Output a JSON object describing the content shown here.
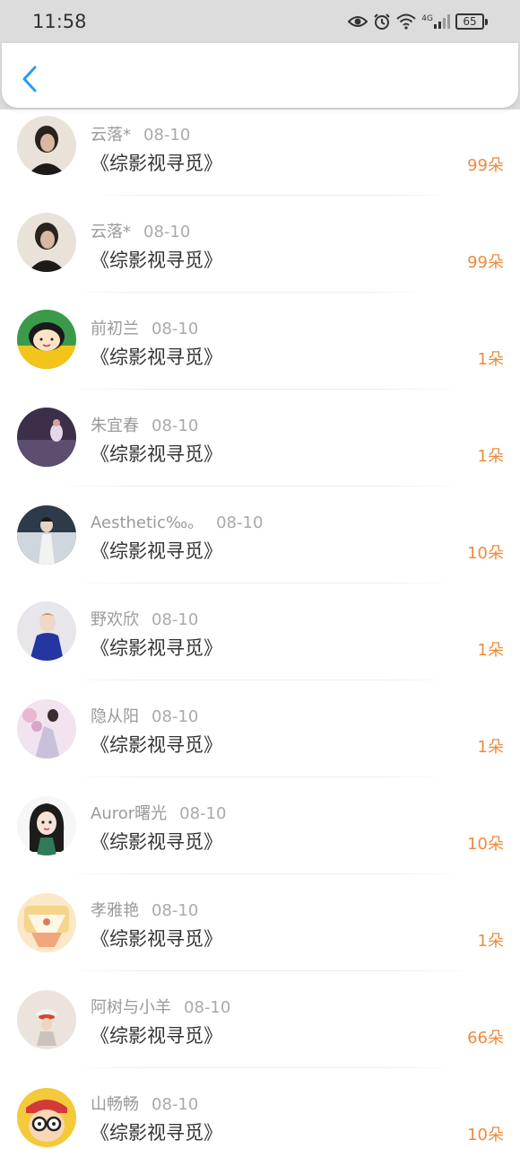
{
  "status_bar": {
    "time": "11:58",
    "battery": "65",
    "network": "4G"
  },
  "header": {
    "back_icon": "chevron-left-icon"
  },
  "colors": {
    "accent_blue": "#2b9cf2",
    "amount_orange": "#f08a3c"
  },
  "items": [
    {
      "name": "云落*",
      "date": "08-10",
      "title": "《综影视寻觅》",
      "amount": "99朵",
      "avatar": "woman-portrait"
    },
    {
      "name": "云落*",
      "date": "08-10",
      "title": "《综影视寻觅》",
      "amount": "99朵",
      "avatar": "woman-portrait"
    },
    {
      "name": "前初兰",
      "date": "08-10",
      "title": "《综影视寻觅》",
      "amount": "1朵",
      "avatar": "cartoon-girl"
    },
    {
      "name": "朱宜春",
      "date": "08-10",
      "title": "《综影视寻觅》",
      "amount": "1朵",
      "avatar": "night-scene"
    },
    {
      "name": "Aesthetic‰。",
      "date": "08-10",
      "title": "《综影视寻觅》",
      "amount": "10朵",
      "avatar": "swordsman"
    },
    {
      "name": "野欢欣",
      "date": "08-10",
      "title": "《综影视寻觅》",
      "amount": "1朵",
      "avatar": "boy-portrait"
    },
    {
      "name": "隐从阳",
      "date": "08-10",
      "title": "《综影视寻觅》",
      "amount": "1朵",
      "avatar": "fantasy-couple"
    },
    {
      "name": "Auror曙光",
      "date": "08-10",
      "title": "《综影视寻觅》",
      "amount": "10朵",
      "avatar": "anime-girl"
    },
    {
      "name": "孝雅艳",
      "date": "08-10",
      "title": "《综影视寻觅》",
      "amount": "1朵",
      "avatar": "cup-illustration"
    },
    {
      "name": "阿树与小羊",
      "date": "08-10",
      "title": "《综影视寻觅》",
      "amount": "66朵",
      "avatar": "girl-with-hat"
    },
    {
      "name": "山畅畅",
      "date": "08-10",
      "title": "《综影视寻觅》",
      "amount": "10朵",
      "avatar": "cartoon-glasses"
    }
  ]
}
